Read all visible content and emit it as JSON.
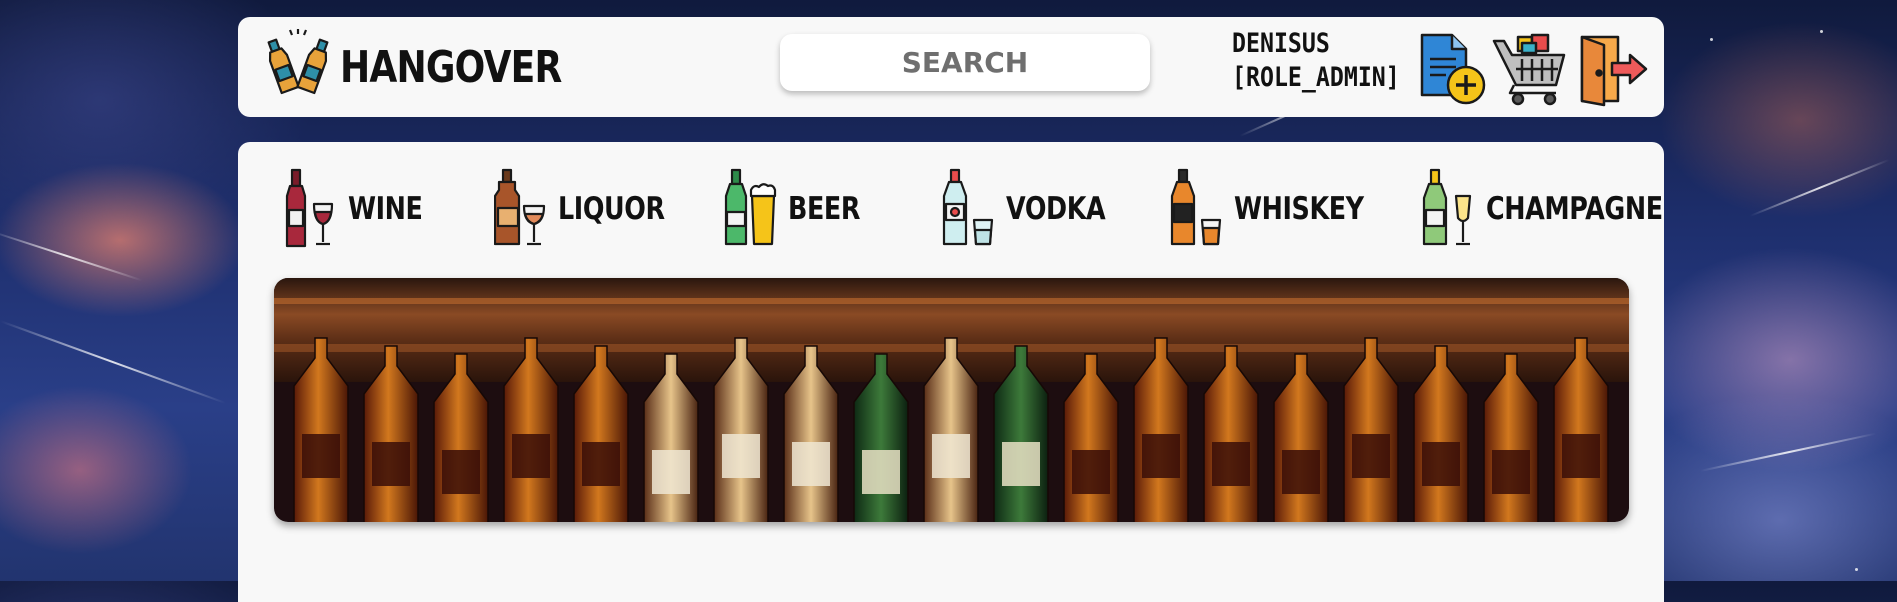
{
  "brand": {
    "name": "HANGOVER",
    "logo_icon": "beer-bottles-cheers-icon"
  },
  "search": {
    "placeholder": "SEARCH"
  },
  "user": {
    "name": "DENISUS",
    "role": "[ROLE_ADMIN]"
  },
  "actions": [
    {
      "name": "add-document",
      "icon": "document-add-icon"
    },
    {
      "name": "cart",
      "icon": "shopping-cart-icon"
    },
    {
      "name": "logout",
      "icon": "exit-door-icon"
    }
  ],
  "categories": [
    {
      "label": "WINE",
      "icon": "wine-icon"
    },
    {
      "label": "LIQUOR",
      "icon": "liquor-icon"
    },
    {
      "label": "BEER",
      "icon": "beer-icon"
    },
    {
      "label": "VODKA",
      "icon": "vodka-icon"
    },
    {
      "label": "WHISKEY",
      "icon": "whiskey-icon"
    },
    {
      "label": "CHAMPAGNE",
      "icon": "champagne-icon"
    }
  ],
  "banner": {
    "image": "bar-shelf-bottles-photo"
  },
  "colors": {
    "card_bg": "#f8f8f8",
    "text": "#111111",
    "search_text": "#6f6f6f",
    "sky": "#1e2f6e"
  }
}
